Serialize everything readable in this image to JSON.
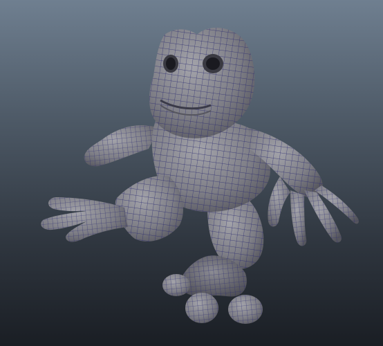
{
  "viewport": {
    "background_top": "#6f7f90",
    "background_bottom": "#1a1e24"
  },
  "model": {
    "kind": "frog-creature",
    "display_mode": "shaded-wireframe",
    "shading_color": "#8a8a90",
    "wire_color": "#2a2a70",
    "parts": [
      "head",
      "eye-left",
      "eye-right",
      "mouth",
      "torso",
      "arm-left",
      "hand-left",
      "arm-right",
      "hand-right",
      "leg-left",
      "foot-left",
      "leg-right",
      "foot-right"
    ]
  }
}
